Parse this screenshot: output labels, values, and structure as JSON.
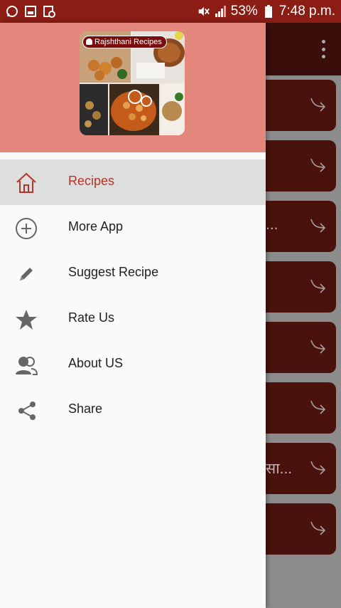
{
  "status_bar": {
    "battery": "53%",
    "time": "7:48 p.m.",
    "icons": [
      "whatsapp-icon",
      "gallery-icon",
      "download-icon",
      "mute-icon",
      "signal-icon",
      "battery-icon"
    ]
  },
  "background_list": {
    "items": [
      {
        "text": ""
      },
      {
        "text": ""
      },
      {
        "text": "..."
      },
      {
        "text": ""
      },
      {
        "text": ""
      },
      {
        "text": ""
      },
      {
        "text": "सा..."
      },
      {
        "text": ""
      }
    ]
  },
  "drawer": {
    "header": {
      "logo_text": "Rajshthani Recipes"
    },
    "menu": [
      {
        "label": "Recipes",
        "icon": "home-icon",
        "active": true
      },
      {
        "label": "More App",
        "icon": "add-circle-icon",
        "active": false
      },
      {
        "label": "Suggest Recipe",
        "icon": "pencil-icon",
        "active": false
      },
      {
        "label": "Rate Us",
        "icon": "star-icon",
        "active": false
      },
      {
        "label": "About US",
        "icon": "people-icon",
        "active": false
      },
      {
        "label": "Share",
        "icon": "share-icon",
        "active": false
      }
    ]
  },
  "colors": {
    "status_bar": "#8b1d15",
    "header": "#e3867b",
    "accent": "#b5342a",
    "card": "#4a120c"
  }
}
